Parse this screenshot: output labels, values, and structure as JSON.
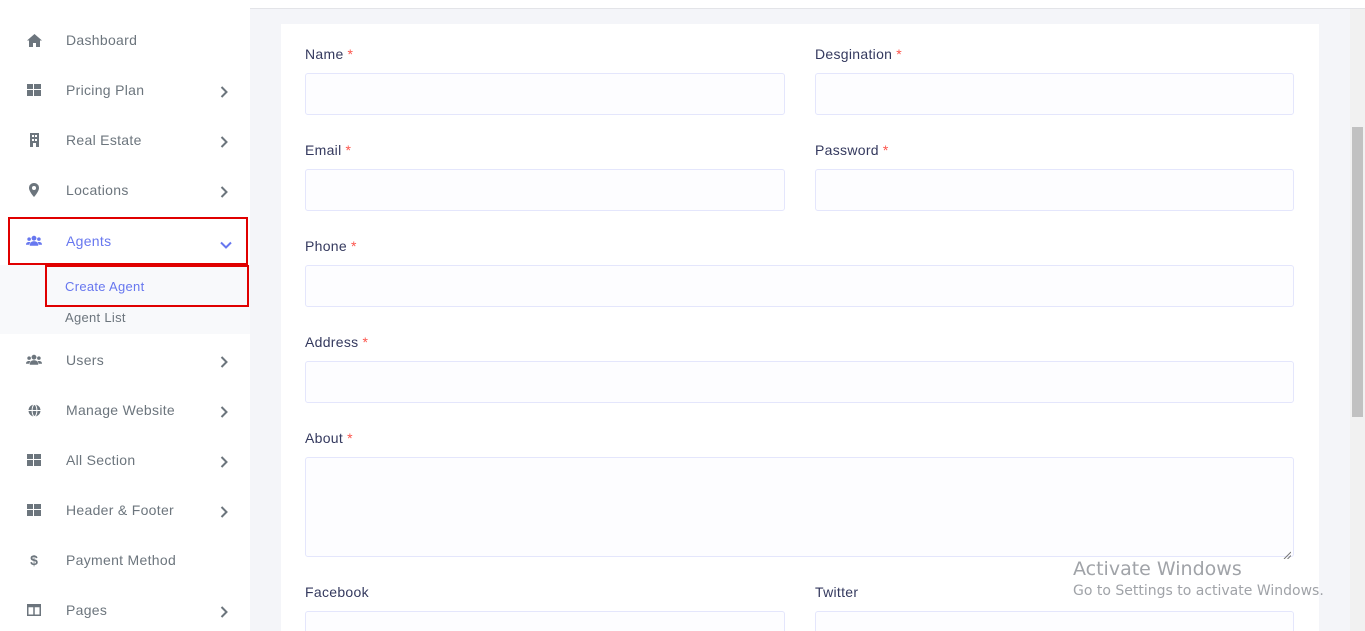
{
  "sidebar": {
    "items": [
      {
        "label": "Dashboard",
        "icon": "home-icon",
        "has_children": false
      },
      {
        "label": "Pricing Plan",
        "icon": "grid-icon",
        "has_children": true
      },
      {
        "label": "Real Estate",
        "icon": "building-icon",
        "has_children": true
      },
      {
        "label": "Locations",
        "icon": "map-marker-icon",
        "has_children": true
      },
      {
        "label": "Agents",
        "icon": "users-icon",
        "has_children": true,
        "expanded": true,
        "active": true
      },
      {
        "label": "Users",
        "icon": "users-icon",
        "has_children": true
      },
      {
        "label": "Manage Website",
        "icon": "globe-icon",
        "has_children": true
      },
      {
        "label": "All Section",
        "icon": "grid-icon",
        "has_children": true
      },
      {
        "label": "Header & Footer",
        "icon": "grid-icon",
        "has_children": true
      },
      {
        "label": "Payment Method",
        "icon": "dollar-icon",
        "has_children": false
      },
      {
        "label": "Pages",
        "icon": "columns-icon",
        "has_children": true
      }
    ],
    "agents_submenu": [
      {
        "label": "Create Agent",
        "active": true
      },
      {
        "label": "Agent List",
        "active": false
      }
    ]
  },
  "form": {
    "name_label": "Name",
    "designation_label": "Desgination",
    "email_label": "Email",
    "password_label": "Password",
    "phone_label": "Phone",
    "address_label": "Address",
    "about_label": "About",
    "facebook_label": "Facebook",
    "twitter_label": "Twitter",
    "required_mark": "*"
  },
  "watermark": {
    "title": "Activate Windows",
    "subtitle": "Go to Settings to activate Windows."
  },
  "colors": {
    "accent": "#6777ef",
    "required": "#fc544b",
    "highlight": "#e00000"
  }
}
